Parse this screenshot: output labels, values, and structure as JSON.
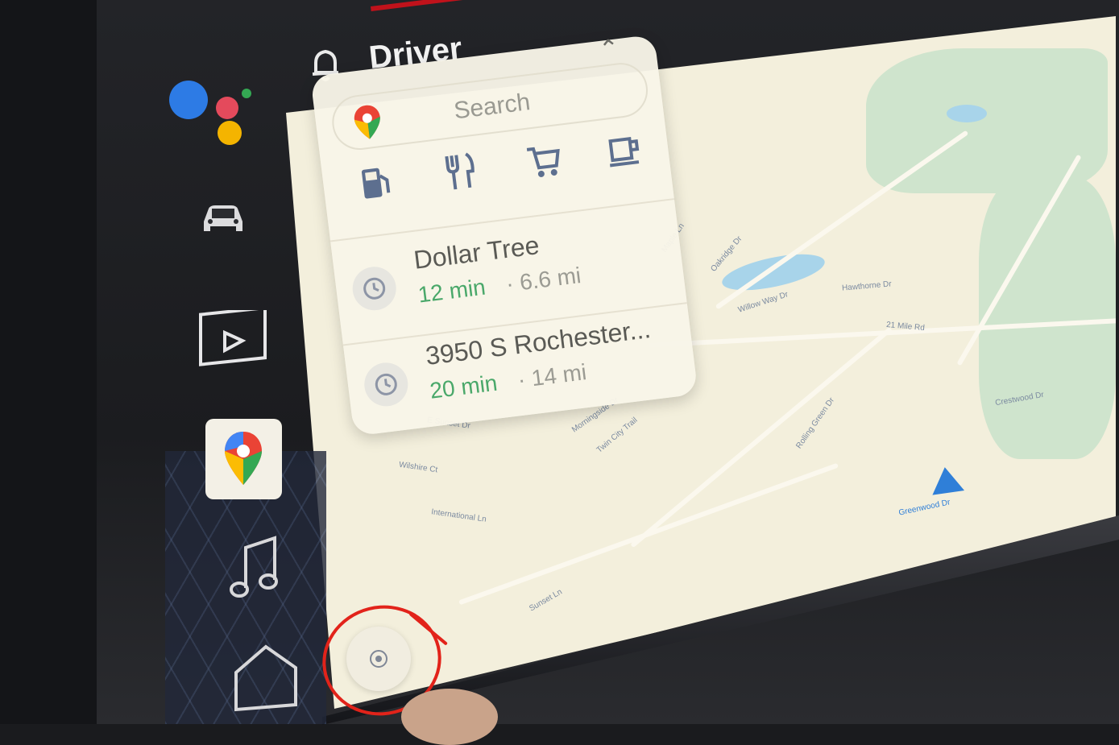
{
  "topbar": {
    "driver_label": "Driver"
  },
  "search": {
    "placeholder": "Search"
  },
  "categories": [
    "gas",
    "restaurants",
    "groceries",
    "coffee"
  ],
  "recents": [
    {
      "name": "Dollar Tree",
      "eta": "12 min",
      "distance": "· 6.6 mi"
    },
    {
      "name": "3950 S Rochester...",
      "eta": "20 min",
      "distance": "· 14 mi"
    }
  ],
  "map_labels": [
    "E Sunset Dr",
    "Wilshire Ct",
    "International Ln",
    "21 Mile Rd",
    "Sunset Ln",
    "Greenwood Dr",
    "Morningside Dr",
    "Twin City Trail",
    "Hawthorne Dr",
    "Maple Ln",
    "Oakridge Dr",
    "Willow Way Dr",
    "Rolling Green Dr",
    "Crestwood Dr"
  ],
  "colors": {
    "accent_blue": "#2f7fd8",
    "eta_green": "#4aa86a",
    "annotation_red": "#e2231a",
    "map_bg": "#f3efdc"
  }
}
